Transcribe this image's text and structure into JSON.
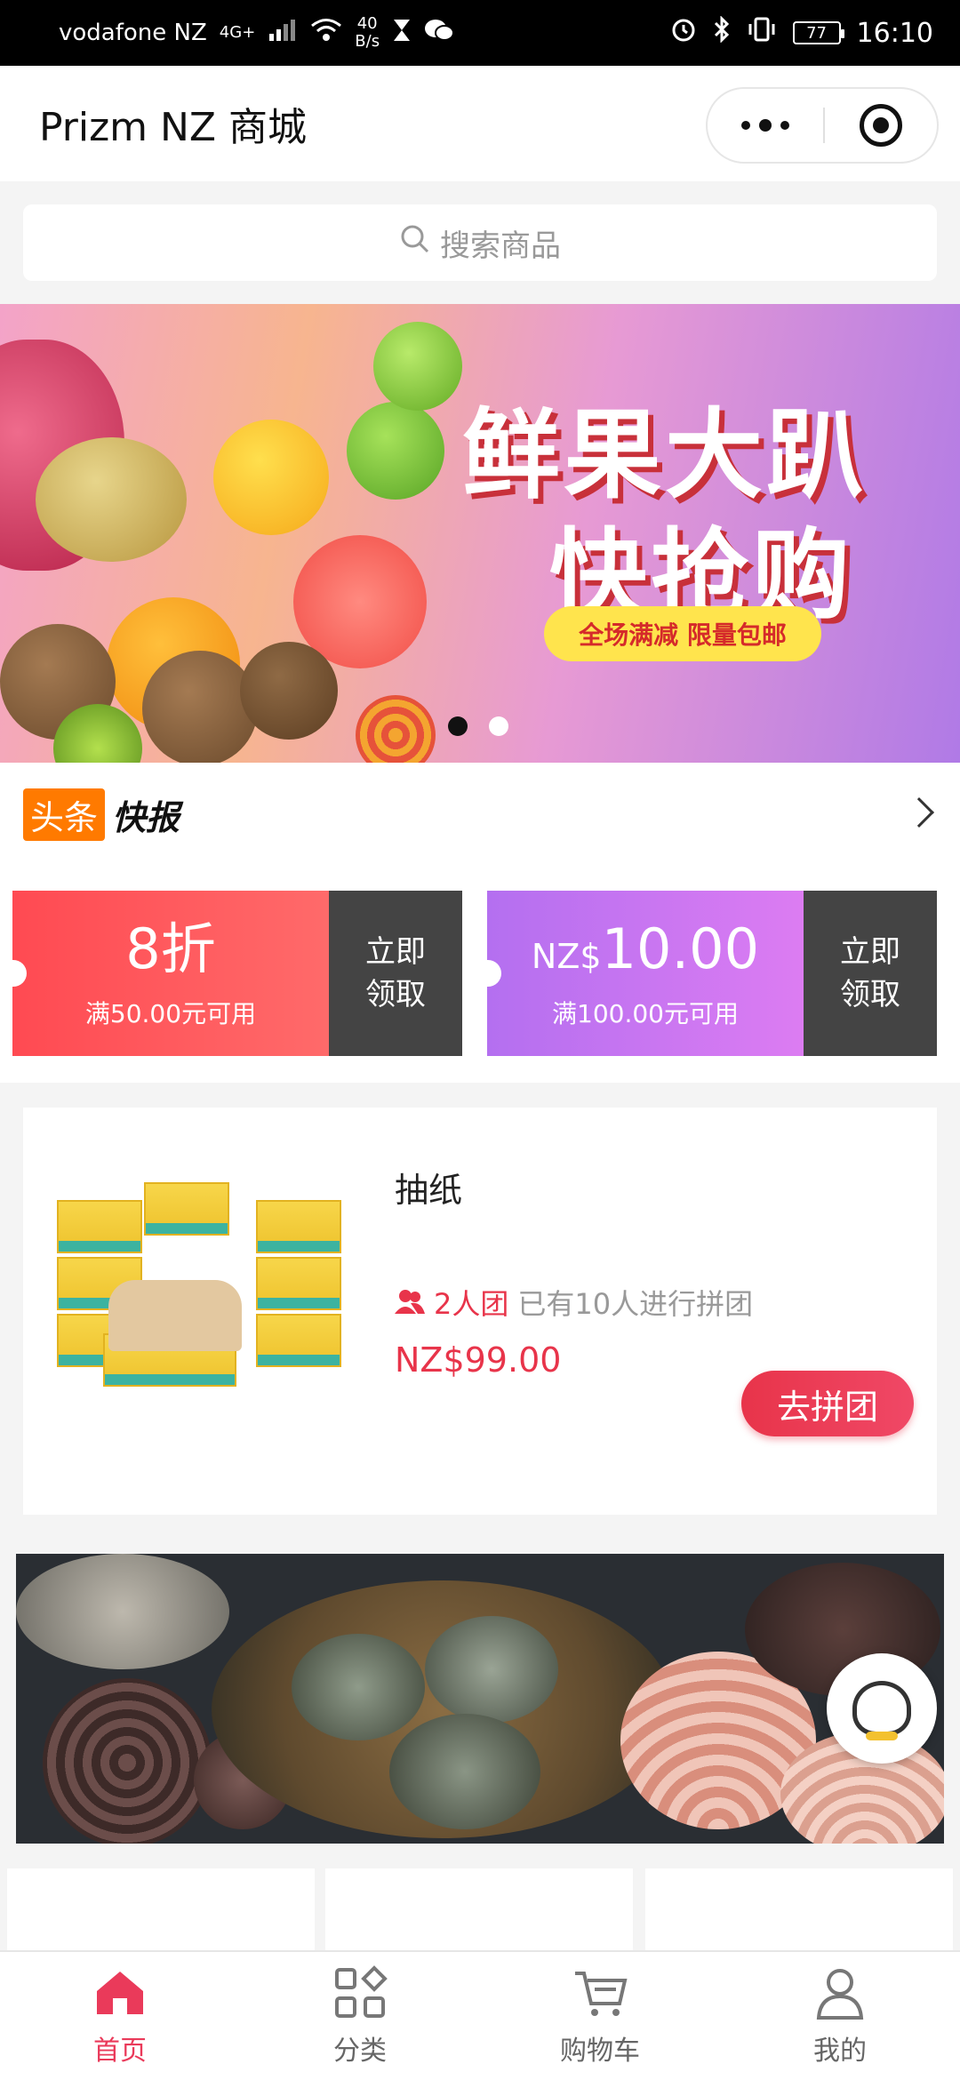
{
  "status_bar": {
    "carrier": "vodafone NZ",
    "network": "4G+",
    "speed_value": "40",
    "speed_unit": "B/s",
    "battery": "77",
    "time": "16:10"
  },
  "header": {
    "title": "Prizm NZ 商城"
  },
  "search": {
    "placeholder": "搜索商品"
  },
  "banner": {
    "line1": "鲜果大趴",
    "line2": "快抢购",
    "tagline": "全场满减 限量包邮",
    "active_slide": 1,
    "slide_count": 2
  },
  "news": {
    "tag": "头条",
    "label": "快报"
  },
  "coupons": [
    {
      "value": "8折",
      "currency": "",
      "condition": "满50.00元可用",
      "action_line1": "立即",
      "action_line2": "领取"
    },
    {
      "value": "10.00",
      "currency": "NZ$",
      "condition": "满100.00元可用",
      "action_line1": "立即",
      "action_line2": "领取"
    }
  ],
  "group_buy": {
    "title": "抽纸",
    "team_size": "2人团",
    "participants": "已有10人进行拼团",
    "price": "NZ$99.00",
    "button": "去拼团"
  },
  "tabbar": {
    "items": [
      {
        "label": "首页",
        "icon": "home-icon",
        "active": true
      },
      {
        "label": "分类",
        "icon": "category-icon",
        "active": false
      },
      {
        "label": "购物车",
        "icon": "cart-icon",
        "active": false
      },
      {
        "label": "我的",
        "icon": "user-icon",
        "active": false
      }
    ]
  },
  "colors": {
    "accent": "#ea3a5a",
    "coupon_red": "#ff4a52",
    "coupon_purple": "#c475f1",
    "news_tag": "#ff7a00"
  }
}
